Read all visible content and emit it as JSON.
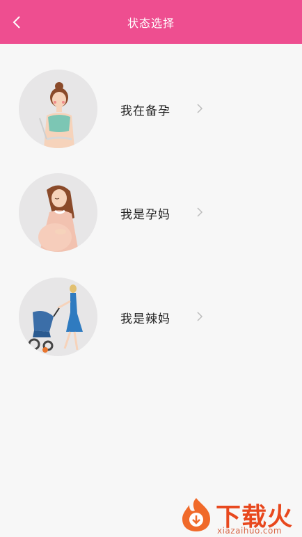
{
  "header": {
    "title": "状态选择",
    "back_icon": "chevron-left-icon",
    "background": "#ee4e90"
  },
  "options": [
    {
      "label": "我在备孕",
      "avatar_icon": "woman-fitness-illustration"
    },
    {
      "label": "我是孕妈",
      "avatar_icon": "pregnant-woman-illustration"
    },
    {
      "label": "我是辣妈",
      "avatar_icon": "mother-with-stroller-illustration"
    }
  ],
  "watermark": {
    "title": "下载火",
    "url": "xiazaihuo.com"
  }
}
